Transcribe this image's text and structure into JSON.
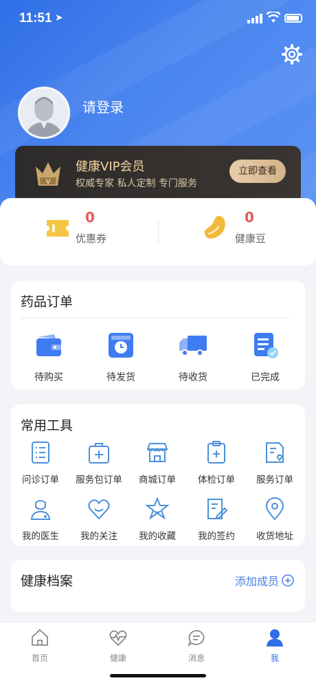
{
  "status": {
    "time": "11:51"
  },
  "profile": {
    "login_label": "请登录"
  },
  "vip": {
    "title": "健康VIP会员",
    "subtitle": "权威专家  私人定制  专门服务",
    "button": "立即查看",
    "badge_letter": "V"
  },
  "benefits": {
    "coupon": {
      "count": "0",
      "label": "优惠券"
    },
    "beans": {
      "count": "0",
      "label": "健康豆"
    }
  },
  "drug_orders": {
    "title": "药品订单",
    "items": [
      {
        "label": "待购买",
        "icon": "wallet-icon"
      },
      {
        "label": "待发货",
        "icon": "clock-box-icon"
      },
      {
        "label": "待收货",
        "icon": "truck-icon"
      },
      {
        "label": "已完成",
        "icon": "document-check-icon"
      }
    ]
  },
  "tools": {
    "title": "常用工具",
    "items": [
      {
        "label": "问诊订单",
        "icon": "list-icon"
      },
      {
        "label": "服务包订单",
        "icon": "medical-kit-icon"
      },
      {
        "label": "商城订单",
        "icon": "store-icon"
      },
      {
        "label": "体检订单",
        "icon": "clipboard-plus-icon"
      },
      {
        "label": "服务订单",
        "icon": "document-heart-icon"
      },
      {
        "label": "我的医生",
        "icon": "doctor-icon"
      },
      {
        "label": "我的关注",
        "icon": "heart-icon"
      },
      {
        "label": "我的收藏",
        "icon": "star-icon"
      },
      {
        "label": "我的签约",
        "icon": "sign-icon"
      },
      {
        "label": "收货地址",
        "icon": "location-icon"
      }
    ]
  },
  "archive": {
    "title": "健康档案",
    "add_label": "添加成员"
  },
  "tabbar": [
    {
      "label": "首页",
      "icon": "home-icon"
    },
    {
      "label": "健康",
      "icon": "health-heart-icon"
    },
    {
      "label": "消息",
      "icon": "message-icon"
    },
    {
      "label": "我",
      "icon": "person-icon",
      "active": true
    }
  ],
  "colors": {
    "primary": "#2f6ee6",
    "accent_red": "#e45a5a",
    "vip_gold": "#f4d59e",
    "coupon_yellow": "#f5c542"
  }
}
